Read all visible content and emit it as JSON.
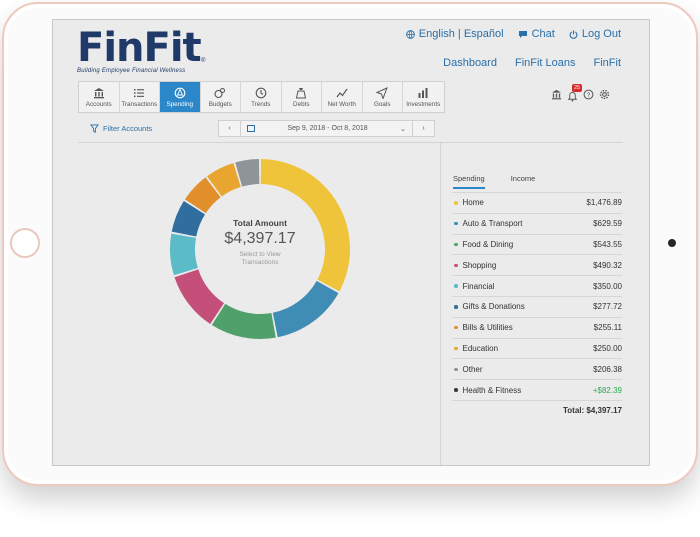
{
  "brand": {
    "name": "FinFit",
    "tagline": "Building Employee Financial Wellness",
    "reg": "®"
  },
  "toplinks": {
    "language": "English | Español",
    "chat": "Chat",
    "logout": "Log Out"
  },
  "nav": {
    "dashboard": "Dashboard",
    "loans": "FinFit Loans",
    "finfit": "FinFit"
  },
  "toolbar": [
    {
      "label": "Accounts",
      "icon": "bank-icon"
    },
    {
      "label": "Transactions",
      "icon": "list-icon"
    },
    {
      "label": "Spending",
      "icon": "spending-icon",
      "active": true
    },
    {
      "label": "Budgets",
      "icon": "budget-icon"
    },
    {
      "label": "Trends",
      "icon": "clock-icon"
    },
    {
      "label": "Debts",
      "icon": "debt-icon"
    },
    {
      "label": "Net Worth",
      "icon": "networth-icon"
    },
    {
      "label": "Goals",
      "icon": "goal-icon"
    },
    {
      "label": "Investments",
      "icon": "chart-icon"
    }
  ],
  "notifications": {
    "count": "25"
  },
  "filter": {
    "label": "Filter Accounts"
  },
  "dates": {
    "range": "Sep 9, 2018 - Oct 8, 2018",
    "prev": "‹",
    "next": "›",
    "caret": "⌄"
  },
  "summary": {
    "title": "Total Amount",
    "amount": "$4,397.17",
    "hint_line1": "Select to View",
    "hint_line2": "Transactions"
  },
  "tabs": {
    "spending": "Spending",
    "income": "Income"
  },
  "categories": [
    {
      "name": "Home",
      "amount": "$1,476.89",
      "color": "#f0c43a"
    },
    {
      "name": "Auto & Transport",
      "amount": "$629.59",
      "color": "#3f8cb4"
    },
    {
      "name": "Food & Dining",
      "amount": "$543.55",
      "color": "#4fa06b"
    },
    {
      "name": "Shopping",
      "amount": "$490.32",
      "color": "#c4507a"
    },
    {
      "name": "Financial",
      "amount": "$350.00",
      "color": "#5bbcc8"
    },
    {
      "name": "Gifts & Donations",
      "amount": "$277.72",
      "color": "#2f6e9e"
    },
    {
      "name": "Bills & Utilities",
      "amount": "$255.11",
      "color": "#e08f2b"
    },
    {
      "name": "Education",
      "amount": "$250.00",
      "color": "#e8a530"
    },
    {
      "name": "Other",
      "amount": "$206.38",
      "color": "#8e9498"
    },
    {
      "name": "Health & Fitness",
      "amount": "+$82.39",
      "color": "#3a3a3a",
      "income": true
    }
  ],
  "donut_values": [
    1476.89,
    629.59,
    543.55,
    490.32,
    350.0,
    277.72,
    255.11,
    250.0,
    206.38
  ],
  "total_label": "Total: $4,397.17",
  "colors": {
    "accent": "#2b87c9",
    "brand": "#1f3a68",
    "link": "#2a6fa8",
    "positive": "#2eaa4f"
  }
}
